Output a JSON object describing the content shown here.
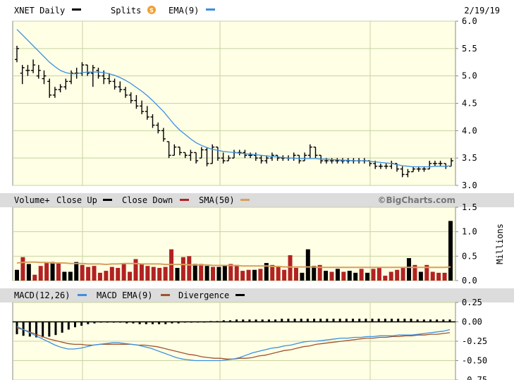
{
  "header": {
    "ticker_label": "XNET Daily",
    "splits_label": "Splits",
    "splits_badge": "S",
    "ema_label": "EMA(9)",
    "date": "2/19/19"
  },
  "volume_header": {
    "volume_label": "Volume+",
    "close_up_label": "Close Up",
    "close_down_label": "Close Down",
    "sma_label": "SMA(50)",
    "brand": "©BigCharts.com"
  },
  "macd_header": {
    "macd_label": "MACD(12,26)",
    "macd_ema_label": "MACD EMA(9)",
    "divergence_label": "Divergence"
  },
  "colors": {
    "panel_bg": "#ffffe6",
    "header_bg": "#dcdcdc",
    "ema_line": "#3a8fe0",
    "close_up": "#000000",
    "close_down": "#b22222",
    "sma_line": "#d9a05b",
    "macd_line": "#3a8fe0",
    "macd_ema_line": "#a0522d",
    "grid": "#c8d2a0"
  },
  "chart_data": [
    {
      "type": "ohlc",
      "title": "XNET Daily",
      "ylim": [
        3.0,
        6.0
      ],
      "yticks": [
        "3.0",
        "3.5",
        "4.0",
        "4.5",
        "5.0",
        "5.5",
        "6.0"
      ],
      "bars": [
        [
          5.55,
          5.25,
          5.3,
          5.5
        ],
        [
          5.2,
          4.85,
          5.05,
          5.15
        ],
        [
          5.2,
          5.0,
          5.1,
          5.1
        ],
        [
          5.3,
          5.05,
          5.1,
          5.2
        ],
        [
          5.2,
          4.95,
          5.0,
          5.1
        ],
        [
          5.1,
          4.85,
          4.95,
          5.0
        ],
        [
          4.95,
          4.6,
          4.9,
          4.65
        ],
        [
          4.8,
          4.6,
          4.65,
          4.75
        ],
        [
          4.85,
          4.7,
          4.75,
          4.8
        ],
        [
          4.95,
          4.75,
          4.8,
          4.9
        ],
        [
          5.1,
          4.85,
          4.9,
          5.05
        ],
        [
          5.15,
          4.95,
          5.05,
          5.05
        ],
        [
          5.25,
          5.0,
          5.05,
          5.2
        ],
        [
          5.2,
          5.0,
          5.2,
          5.05
        ],
        [
          5.2,
          4.8,
          5.05,
          5.15
        ],
        [
          5.15,
          4.95,
          5.1,
          5.0
        ],
        [
          5.1,
          4.85,
          5.0,
          4.95
        ],
        [
          5.05,
          4.85,
          4.95,
          4.9
        ],
        [
          4.95,
          4.75,
          4.9,
          4.8
        ],
        [
          4.9,
          4.7,
          4.8,
          4.75
        ],
        [
          4.8,
          4.6,
          4.75,
          4.65
        ],
        [
          4.7,
          4.5,
          4.65,
          4.55
        ],
        [
          4.65,
          4.4,
          4.55,
          4.45
        ],
        [
          4.55,
          4.3,
          4.45,
          4.35
        ],
        [
          4.45,
          4.2,
          4.35,
          4.25
        ],
        [
          4.3,
          4.05,
          4.25,
          4.1
        ],
        [
          4.15,
          3.95,
          4.1,
          4.0
        ],
        [
          4.05,
          3.8,
          4.0,
          3.85
        ],
        [
          3.8,
          3.5,
          3.8,
          3.55
        ],
        [
          3.75,
          3.55,
          3.55,
          3.7
        ],
        [
          3.7,
          3.55,
          3.7,
          3.6
        ],
        [
          3.6,
          3.5,
          3.6,
          3.55
        ],
        [
          3.65,
          3.45,
          3.55,
          3.6
        ],
        [
          3.6,
          3.4,
          3.6,
          3.45
        ],
        [
          3.7,
          3.5,
          3.5,
          3.65
        ],
        [
          3.7,
          3.35,
          3.65,
          3.4
        ],
        [
          3.75,
          3.4,
          3.4,
          3.7
        ],
        [
          3.7,
          3.45,
          3.7,
          3.5
        ],
        [
          3.6,
          3.4,
          3.5,
          3.45
        ],
        [
          3.55,
          3.45,
          3.45,
          3.5
        ],
        [
          3.65,
          3.5,
          3.5,
          3.6
        ],
        [
          3.65,
          3.55,
          3.6,
          3.6
        ],
        [
          3.65,
          3.5,
          3.6,
          3.55
        ],
        [
          3.6,
          3.5,
          3.55,
          3.55
        ],
        [
          3.6,
          3.45,
          3.55,
          3.5
        ],
        [
          3.55,
          3.4,
          3.5,
          3.45
        ],
        [
          3.55,
          3.4,
          3.45,
          3.5
        ],
        [
          3.6,
          3.45,
          3.5,
          3.55
        ],
        [
          3.55,
          3.45,
          3.55,
          3.5
        ],
        [
          3.55,
          3.45,
          3.5,
          3.5
        ],
        [
          3.55,
          3.45,
          3.5,
          3.5
        ],
        [
          3.6,
          3.45,
          3.5,
          3.55
        ],
        [
          3.55,
          3.4,
          3.55,
          3.45
        ],
        [
          3.6,
          3.45,
          3.45,
          3.55
        ],
        [
          3.75,
          3.5,
          3.55,
          3.7
        ],
        [
          3.7,
          3.5,
          3.7,
          3.55
        ],
        [
          3.55,
          3.4,
          3.55,
          3.45
        ],
        [
          3.5,
          3.4,
          3.45,
          3.45
        ],
        [
          3.5,
          3.4,
          3.45,
          3.45
        ],
        [
          3.5,
          3.4,
          3.45,
          3.45
        ],
        [
          3.5,
          3.4,
          3.45,
          3.45
        ],
        [
          3.5,
          3.4,
          3.45,
          3.45
        ],
        [
          3.5,
          3.4,
          3.45,
          3.45
        ],
        [
          3.5,
          3.4,
          3.45,
          3.45
        ],
        [
          3.5,
          3.4,
          3.45,
          3.45
        ],
        [
          3.45,
          3.35,
          3.45,
          3.4
        ],
        [
          3.45,
          3.3,
          3.4,
          3.35
        ],
        [
          3.4,
          3.3,
          3.35,
          3.35
        ],
        [
          3.4,
          3.3,
          3.35,
          3.35
        ],
        [
          3.45,
          3.3,
          3.35,
          3.4
        ],
        [
          3.4,
          3.25,
          3.4,
          3.3
        ],
        [
          3.35,
          3.15,
          3.3,
          3.2
        ],
        [
          3.3,
          3.15,
          3.2,
          3.25
        ],
        [
          3.35,
          3.25,
          3.25,
          3.3
        ],
        [
          3.35,
          3.25,
          3.3,
          3.3
        ],
        [
          3.35,
          3.25,
          3.3,
          3.3
        ],
        [
          3.45,
          3.3,
          3.3,
          3.4
        ],
        [
          3.45,
          3.35,
          3.4,
          3.4
        ],
        [
          3.45,
          3.35,
          3.4,
          3.4
        ],
        [
          3.4,
          3.3,
          3.4,
          3.35
        ],
        [
          3.5,
          3.35,
          3.35,
          3.45
        ]
      ],
      "ema": [
        5.85,
        5.75,
        5.65,
        5.55,
        5.45,
        5.35,
        5.25,
        5.17,
        5.1,
        5.06,
        5.04,
        5.04,
        5.06,
        5.07,
        5.07,
        5.07,
        5.06,
        5.04,
        5.01,
        4.97,
        4.92,
        4.86,
        4.79,
        4.72,
        4.64,
        4.55,
        4.45,
        4.35,
        4.23,
        4.11,
        4.01,
        3.93,
        3.85,
        3.78,
        3.73,
        3.69,
        3.66,
        3.64,
        3.62,
        3.61,
        3.6,
        3.59,
        3.58,
        3.57,
        3.56,
        3.55,
        3.54,
        3.53,
        3.52,
        3.51,
        3.5,
        3.5,
        3.49,
        3.49,
        3.49,
        3.49,
        3.48,
        3.48,
        3.47,
        3.47,
        3.46,
        3.46,
        3.45,
        3.45,
        3.45,
        3.44,
        3.43,
        3.42,
        3.41,
        3.4,
        3.38,
        3.36,
        3.35,
        3.34,
        3.34,
        3.34,
        3.34,
        3.35,
        3.35,
        3.35,
        3.36
      ]
    },
    {
      "type": "bar",
      "title": "Volume+",
      "unit": "Millions",
      "ylim": [
        0.0,
        1.5
      ],
      "yticks": [
        "0.0",
        "0.5",
        "1.0",
        "1.5"
      ],
      "series": [
        {
          "name": "Close Up",
          "up": true
        },
        {
          "name": "Close Down",
          "up": false
        },
        {
          "name": "SMA(50)"
        }
      ],
      "volumes": [
        0.22,
        0.48,
        0.34,
        0.12,
        0.3,
        0.36,
        0.38,
        0.36,
        0.18,
        0.18,
        0.38,
        0.32,
        0.28,
        0.3,
        0.16,
        0.2,
        0.28,
        0.26,
        0.36,
        0.18,
        0.44,
        0.34,
        0.3,
        0.28,
        0.26,
        0.28,
        0.64,
        0.26,
        0.48,
        0.5,
        0.34,
        0.34,
        0.3,
        0.28,
        0.28,
        0.3,
        0.34,
        0.32,
        0.2,
        0.22,
        0.22,
        0.24,
        0.36,
        0.32,
        0.3,
        0.22,
        0.52,
        0.26,
        0.16,
        0.64,
        0.3,
        0.32,
        0.2,
        0.18,
        0.24,
        0.18,
        0.2,
        0.16,
        0.24,
        0.16,
        0.24,
        0.28,
        0.1,
        0.18,
        0.22,
        0.26,
        0.46,
        0.32,
        0.18,
        0.32,
        0.18,
        0.16,
        0.16,
        1.22
      ],
      "closed_up": [
        true,
        false,
        true,
        false,
        false,
        false,
        true,
        false,
        true,
        true,
        true,
        false,
        false,
        false,
        false,
        false,
        false,
        false,
        false,
        false,
        false,
        false,
        false,
        false,
        false,
        false,
        false,
        true,
        false,
        false,
        true,
        false,
        true,
        false,
        true,
        true,
        false,
        false,
        false,
        false,
        true,
        false,
        true,
        false,
        false,
        false,
        false,
        false,
        true,
        true,
        true,
        false,
        true,
        false,
        true,
        false,
        true,
        true,
        false,
        true,
        false,
        false,
        false,
        false,
        false,
        false,
        true,
        false,
        true,
        false,
        false,
        false,
        false,
        true
      ],
      "sma": [
        0.36,
        0.37,
        0.38,
        0.38,
        0.37,
        0.37,
        0.36,
        0.36,
        0.36,
        0.35,
        0.35,
        0.35,
        0.34,
        0.34,
        0.34,
        0.33,
        0.34,
        0.34,
        0.35,
        0.35,
        0.35,
        0.34,
        0.34,
        0.34,
        0.34,
        0.33,
        0.33,
        0.33,
        0.33,
        0.32,
        0.32,
        0.32,
        0.32,
        0.31,
        0.31,
        0.31,
        0.31,
        0.31,
        0.3,
        0.3,
        0.3,
        0.3,
        0.3,
        0.29,
        0.29,
        0.28,
        0.28,
        0.28,
        0.28,
        0.28,
        0.28,
        0.27,
        0.27,
        0.27,
        0.27,
        0.27,
        0.27,
        0.27,
        0.27,
        0.27,
        0.27,
        0.27,
        0.27,
        0.27,
        0.27,
        0.27,
        0.27,
        0.27,
        0.27,
        0.27,
        0.27,
        0.27,
        0.27,
        0.28
      ]
    },
    {
      "type": "line",
      "title": "MACD(12,26)",
      "ylim": [
        -0.75,
        0.25
      ],
      "yticks": [
        "0.25",
        "0.00",
        "-0.25",
        "-0.50",
        "-0.75"
      ],
      "series": [
        {
          "name": "MACD(12,26)",
          "values": [
            -0.06,
            -0.1,
            -0.14,
            -0.18,
            -0.22,
            -0.26,
            -0.3,
            -0.33,
            -0.35,
            -0.35,
            -0.34,
            -0.32,
            -0.3,
            -0.29,
            -0.28,
            -0.27,
            -0.27,
            -0.28,
            -0.29,
            -0.3,
            -0.32,
            -0.34,
            -0.37,
            -0.4,
            -0.43,
            -0.46,
            -0.48,
            -0.49,
            -0.5,
            -0.5,
            -0.5,
            -0.5,
            -0.5,
            -0.49,
            -0.48,
            -0.46,
            -0.43,
            -0.4,
            -0.38,
            -0.36,
            -0.34,
            -0.33,
            -0.31,
            -0.3,
            -0.28,
            -0.26,
            -0.25,
            -0.25,
            -0.24,
            -0.23,
            -0.22,
            -0.21,
            -0.21,
            -0.2,
            -0.2,
            -0.19,
            -0.19,
            -0.18,
            -0.18,
            -0.18,
            -0.17,
            -0.17,
            -0.17,
            -0.16,
            -0.15,
            -0.14,
            -0.13,
            -0.12,
            -0.1
          ]
        },
        {
          "name": "MACD EMA(9)",
          "values": [
            -0.08,
            -0.1,
            -0.13,
            -0.16,
            -0.19,
            -0.22,
            -0.24,
            -0.26,
            -0.28,
            -0.29,
            -0.29,
            -0.3,
            -0.3,
            -0.29,
            -0.29,
            -0.29,
            -0.29,
            -0.29,
            -0.29,
            -0.3,
            -0.3,
            -0.31,
            -0.32,
            -0.34,
            -0.36,
            -0.38,
            -0.4,
            -0.42,
            -0.43,
            -0.45,
            -0.46,
            -0.47,
            -0.47,
            -0.48,
            -0.48,
            -0.47,
            -0.47,
            -0.46,
            -0.44,
            -0.43,
            -0.41,
            -0.39,
            -0.37,
            -0.36,
            -0.34,
            -0.32,
            -0.31,
            -0.29,
            -0.28,
            -0.27,
            -0.26,
            -0.25,
            -0.24,
            -0.23,
            -0.22,
            -0.21,
            -0.21,
            -0.2,
            -0.2,
            -0.19,
            -0.19,
            -0.18,
            -0.18,
            -0.17,
            -0.17,
            -0.16,
            -0.16,
            -0.15,
            -0.14
          ]
        },
        {
          "name": "Divergence",
          "values": [
            -0.16,
            -0.18,
            -0.19,
            -0.2,
            -0.2,
            -0.19,
            -0.17,
            -0.14,
            -0.1,
            -0.07,
            -0.05,
            -0.03,
            -0.02,
            -0.01,
            -0.01,
            -0.01,
            -0.01,
            -0.02,
            -0.02,
            -0.03,
            -0.03,
            -0.03,
            -0.03,
            -0.03,
            -0.02,
            -0.02,
            -0.01,
            -0.01,
            0.0,
            0.0,
            0.01,
            0.01,
            0.02,
            0.02,
            0.03,
            0.03,
            0.03,
            0.03,
            0.03,
            0.03,
            0.03,
            0.04,
            0.04,
            0.04,
            0.04,
            0.04,
            0.04,
            0.04,
            0.04,
            0.04,
            0.04,
            0.04,
            0.04,
            0.04,
            0.04,
            0.04,
            0.04,
            0.04,
            0.04,
            0.04,
            0.04,
            0.04,
            0.03,
            0.03,
            0.03,
            0.03,
            0.03,
            0.03
          ]
        }
      ]
    }
  ]
}
